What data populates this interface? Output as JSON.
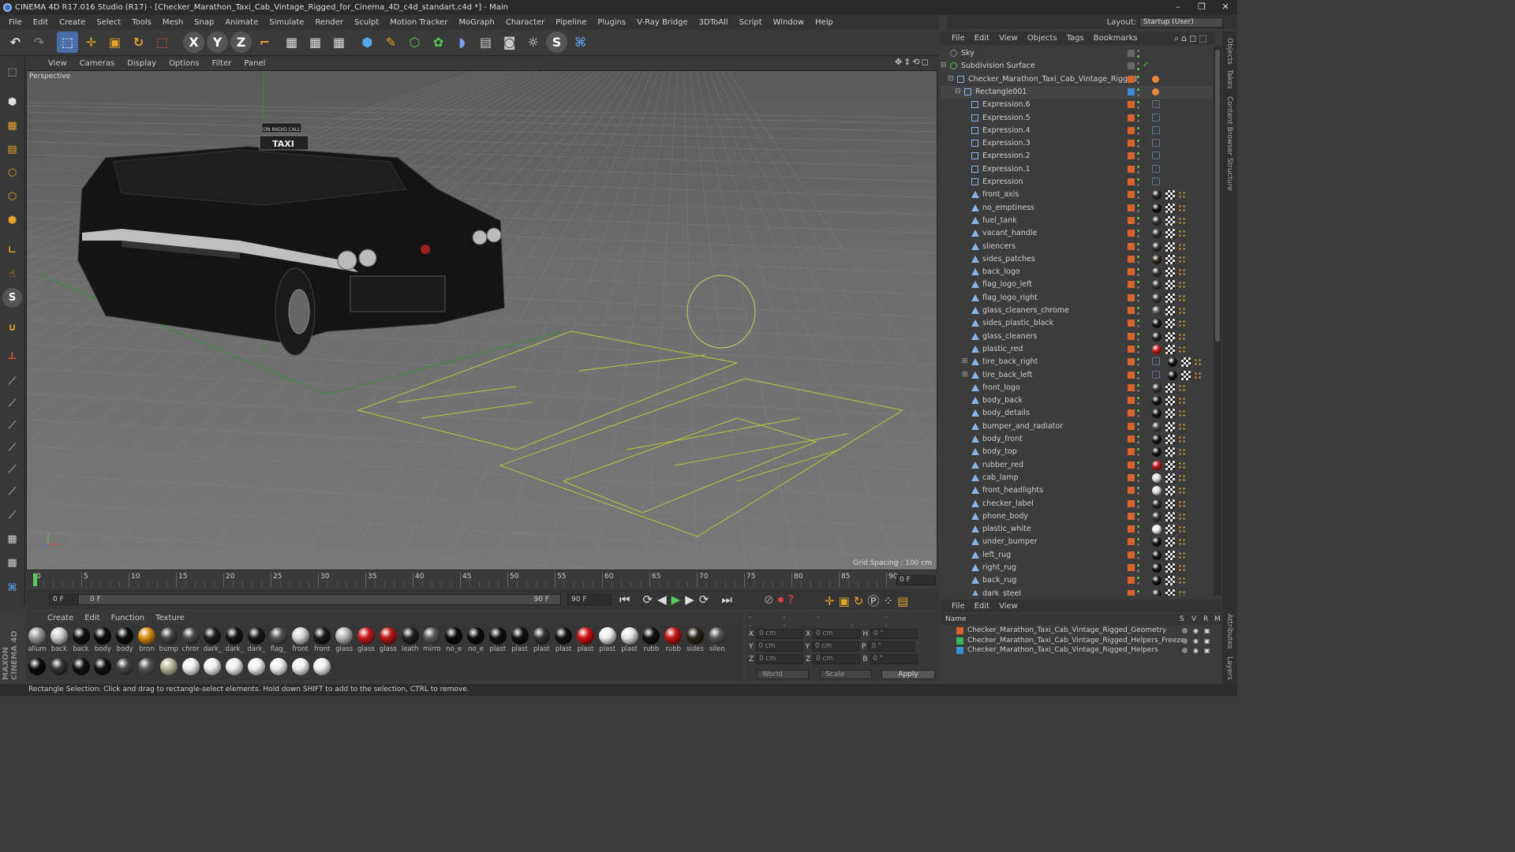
{
  "window": {
    "title": "CINEMA 4D R17.016 Studio (R17) - [Checker_Marathon_Taxi_Cab_Vintage_Rigged_for_Cinema_4D_c4d_standart.c4d *] - Main"
  },
  "menu": [
    "File",
    "Edit",
    "Create",
    "Select",
    "Tools",
    "Mesh",
    "Snap",
    "Animate",
    "Simulate",
    "Render",
    "Sculpt",
    "Motion Tracker",
    "MoGraph",
    "Character",
    "Pipeline",
    "Plugins",
    "V-Ray Bridge",
    "3DToAll",
    "Script",
    "Window",
    "Help"
  ],
  "layout": {
    "label": "Layout:",
    "value": "Startup (User)"
  },
  "viewport": {
    "menu": [
      "View",
      "Cameras",
      "Display",
      "Options",
      "Filter",
      "Panel"
    ],
    "label": "Perspective",
    "grid_spacing": "Grid Spacing : 100 cm",
    "taxi_sign": "TAXI",
    "radio_sign": "ON RADIO CALL"
  },
  "timeline": {
    "ticks": [
      "0",
      "5",
      "10",
      "15",
      "20",
      "25",
      "30",
      "35",
      "40",
      "45",
      "50",
      "55",
      "60",
      "65",
      "70",
      "75",
      "80",
      "85",
      "90"
    ],
    "end_frame": "0 F"
  },
  "playbar": {
    "start": "0 F",
    "range_start": "0 F",
    "range_end": "90 F",
    "end": "90 F"
  },
  "materials": {
    "menu": [
      "Create",
      "Edit",
      "Function",
      "Texture"
    ],
    "row1": [
      {
        "label": "allum",
        "color": "#9a9a9a"
      },
      {
        "label": "back",
        "color": "#d0d0d0"
      },
      {
        "label": "back",
        "color": "#111"
      },
      {
        "label": "body",
        "color": "#0c0c0c"
      },
      {
        "label": "body",
        "color": "#0c0c0c"
      },
      {
        "label": "bron",
        "color": "#d88a12"
      },
      {
        "label": "bump",
        "color": "#444"
      },
      {
        "label": "chror",
        "color": "#4a4a4a"
      },
      {
        "label": "dark_",
        "color": "#1c1c1c"
      },
      {
        "label": "dark_",
        "color": "#141414"
      },
      {
        "label": "dark_",
        "color": "#181818"
      },
      {
        "label": "flag_",
        "color": "#555"
      },
      {
        "label": "front",
        "color": "#d8d8d8"
      },
      {
        "label": "front",
        "color": "#1a1a1a"
      },
      {
        "label": "glass",
        "color": "#b8b8b8"
      },
      {
        "label": "glass",
        "color": "#c41a1a"
      },
      {
        "label": "glass",
        "color": "#b81515"
      },
      {
        "label": "leath",
        "color": "#222"
      },
      {
        "label": "mirro",
        "color": "#5a5a5a"
      },
      {
        "label": "no_e",
        "color": "#0a0a0a"
      },
      {
        "label": "no_e",
        "color": "#0a0a0a"
      },
      {
        "label": "plast",
        "color": "#111"
      },
      {
        "label": "plast",
        "color": "#111"
      },
      {
        "label": "plast",
        "color": "#333"
      },
      {
        "label": "plast",
        "color": "#111"
      },
      {
        "label": "plast",
        "color": "#cc1212"
      },
      {
        "label": "plast",
        "color": "#eeeeee"
      },
      {
        "label": "plast",
        "color": "#e5e5e5"
      },
      {
        "label": "rubb",
        "color": "#111"
      },
      {
        "label": "rubb",
        "color": "#c01414"
      },
      {
        "label": "sides",
        "color": "#2a2418"
      },
      {
        "label": "silen",
        "color": "#555"
      }
    ],
    "row2": [
      {
        "color": "#0b0b0b"
      },
      {
        "color": "#333"
      },
      {
        "color": "#111"
      },
      {
        "color": "#111"
      },
      {
        "color": "#444"
      },
      {
        "color": "#555"
      },
      {
        "color": "#b8b89a"
      },
      {
        "color": "#f0f0f0"
      },
      {
        "color": "#f0f0f0"
      },
      {
        "color": "#f0f0f0"
      },
      {
        "color": "#f0f0f0"
      },
      {
        "color": "#f0f0f0"
      },
      {
        "color": "#f0f0f0"
      },
      {
        "color": "#f0f0f0"
      }
    ]
  },
  "coords": {
    "rows": [
      {
        "a": "X",
        "av": "0 cm",
        "b": "X",
        "bv": "0 cm",
        "c": "H",
        "cv": "0 °"
      },
      {
        "a": "Y",
        "av": "0 cm",
        "b": "Y",
        "bv": "0 cm",
        "c": "P",
        "cv": "0 °"
      },
      {
        "a": "Z",
        "av": "0 cm",
        "b": "Z",
        "bv": "0 cm",
        "c": "B",
        "cv": "0 °"
      }
    ],
    "world": "World",
    "scale": "Scale",
    "apply": "Apply"
  },
  "objects": {
    "menu": [
      "File",
      "Edit",
      "View",
      "Objects",
      "Tags",
      "Bookmarks"
    ],
    "items": [
      {
        "name": "Sky",
        "depth": 0,
        "kind": "sky"
      },
      {
        "name": "Subdivision Surface",
        "depth": 0,
        "kind": "subd"
      },
      {
        "name": "Checker_Marathon_Taxi_Cab_Vintage_Rigged",
        "depth": 1,
        "kind": "null"
      },
      {
        "name": "Rectangle001",
        "depth": 2,
        "kind": "spline"
      },
      {
        "name": "Expression.6",
        "depth": 3,
        "kind": "null"
      },
      {
        "name": "Expression.5",
        "depth": 3,
        "kind": "null"
      },
      {
        "name": "Expression.4",
        "depth": 3,
        "kind": "null"
      },
      {
        "name": "Expression.3",
        "depth": 3,
        "kind": "null"
      },
      {
        "name": "Expression.2",
        "depth": 3,
        "kind": "null"
      },
      {
        "name": "Expression.1",
        "depth": 3,
        "kind": "null"
      },
      {
        "name": "Expression",
        "depth": 3,
        "kind": "null"
      },
      {
        "name": "front_axis",
        "depth": 3,
        "kind": "poly",
        "mat": "#222"
      },
      {
        "name": "no_emptiness",
        "depth": 3,
        "kind": "poly",
        "mat": "#111"
      },
      {
        "name": "fuel_tank",
        "depth": 3,
        "kind": "poly",
        "mat": "#333"
      },
      {
        "name": "vacant_handle",
        "depth": 3,
        "kind": "poly",
        "mat": "#333"
      },
      {
        "name": "sliencers",
        "depth": 3,
        "kind": "poly",
        "mat": "#333"
      },
      {
        "name": "sides_patches",
        "depth": 3,
        "kind": "poly",
        "mat": "#2a2418"
      },
      {
        "name": "back_logo",
        "depth": 3,
        "kind": "poly",
        "mat": "#333"
      },
      {
        "name": "flag_logo_left",
        "depth": 3,
        "kind": "poly",
        "mat": "#333"
      },
      {
        "name": "flag_logo_right",
        "depth": 3,
        "kind": "poly",
        "mat": "#333"
      },
      {
        "name": "glass_cleaners_chrome",
        "depth": 3,
        "kind": "poly",
        "mat": "#555"
      },
      {
        "name": "sides_plastic_black",
        "depth": 3,
        "kind": "poly",
        "mat": "#111"
      },
      {
        "name": "glass_cleaners",
        "depth": 3,
        "kind": "poly",
        "mat": "#222"
      },
      {
        "name": "plastic_red",
        "depth": 3,
        "kind": "poly",
        "mat": "#c01414"
      },
      {
        "name": "tire_back_right",
        "depth": 3,
        "kind": "poly",
        "mat": "#111"
      },
      {
        "name": "tire_back_left",
        "depth": 3,
        "kind": "poly",
        "mat": "#111"
      },
      {
        "name": "front_logo",
        "depth": 3,
        "kind": "poly",
        "mat": "#333"
      },
      {
        "name": "body_back",
        "depth": 3,
        "kind": "poly",
        "mat": "#111"
      },
      {
        "name": "body_details",
        "depth": 3,
        "kind": "poly",
        "mat": "#111"
      },
      {
        "name": "bumper_and_radiator",
        "depth": 3,
        "kind": "poly",
        "mat": "#444"
      },
      {
        "name": "body_front",
        "depth": 3,
        "kind": "poly",
        "mat": "#111"
      },
      {
        "name": "body_top",
        "depth": 3,
        "kind": "poly",
        "mat": "#111"
      },
      {
        "name": "rubber_red",
        "depth": 3,
        "kind": "poly",
        "mat": "#c01414"
      },
      {
        "name": "cab_lamp",
        "depth": 3,
        "kind": "poly",
        "mat": "#ddd"
      },
      {
        "name": "front_headlights",
        "depth": 3,
        "kind": "poly",
        "mat": "#ddd"
      },
      {
        "name": "checker_label",
        "depth": 3,
        "kind": "poly",
        "mat": "#222"
      },
      {
        "name": "phone_body",
        "depth": 3,
        "kind": "poly",
        "mat": "#333"
      },
      {
        "name": "plastic_white",
        "depth": 3,
        "kind": "poly",
        "mat": "#eee"
      },
      {
        "name": "under_bumper",
        "depth": 3,
        "kind": "poly",
        "mat": "#111"
      },
      {
        "name": "left_rug",
        "depth": 3,
        "kind": "poly",
        "mat": "#111"
      },
      {
        "name": "right_rug",
        "depth": 3,
        "kind": "poly",
        "mat": "#111"
      },
      {
        "name": "back_rug",
        "depth": 3,
        "kind": "poly",
        "mat": "#111"
      },
      {
        "name": "dark_steel",
        "depth": 3,
        "kind": "poly",
        "mat": "#222"
      }
    ]
  },
  "layers": {
    "menu": [
      "File",
      "Edit",
      "View"
    ],
    "header": {
      "name": "Name",
      "s": "S",
      "v": "V",
      "r": "R",
      "m": "M"
    },
    "items": [
      {
        "name": "Checker_Marathon_Taxi_Cab_Vintage_Rigged_Geometry",
        "color": "#d8632b"
      },
      {
        "name": "Checker_Marathon_Taxi_Cab_Vintage_Rigged_Helpers_Freeze",
        "color": "#3db35a"
      },
      {
        "name": "Checker_Marathon_Taxi_Cab_Vintage_Rigged_Helpers",
        "color": "#3c8ed8"
      }
    ]
  },
  "right_tabs": [
    "Objects",
    "Takes",
    "Content Browser",
    "Structure",
    "Attributes",
    "Layers"
  ],
  "status": "Rectangle Selection: Click and drag to rectangle-select elements. Hold down SHIFT to add to the selection, CTRL to remove.",
  "brand": "MAXON CINEMA 4D"
}
